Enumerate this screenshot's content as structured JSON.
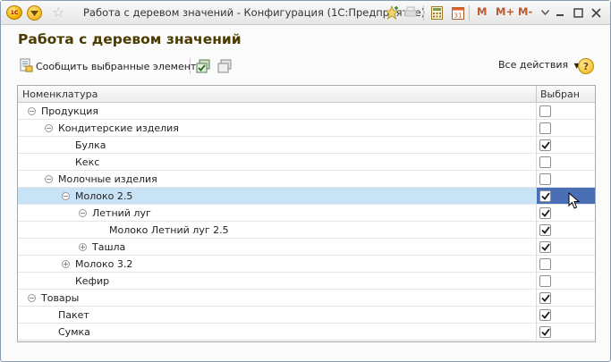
{
  "window": {
    "title": "Работа с деревом значений - Конфигурация  (1С:Предприятие)",
    "logo_text": "1C",
    "toolbar_m": [
      "M",
      "M+",
      "M-"
    ]
  },
  "page": {
    "title": "Работа с деревом значений"
  },
  "toolbar": {
    "report_label": "Сообщить выбранные элементы",
    "all_actions_label": "Все действия",
    "help_label": "?"
  },
  "table": {
    "headers": {
      "name": "Номенклатура",
      "selected": "Выбран"
    },
    "rows": [
      {
        "label": "Продукция",
        "level": 0,
        "toggle": "collapse",
        "checked": false,
        "selected": false
      },
      {
        "label": "Кондитерские изделия",
        "level": 1,
        "toggle": "collapse",
        "checked": false,
        "selected": false
      },
      {
        "label": "Булка",
        "level": 2,
        "toggle": "none",
        "checked": true,
        "selected": false
      },
      {
        "label": "Кекс",
        "level": 2,
        "toggle": "none",
        "checked": false,
        "selected": false
      },
      {
        "label": "Молочные изделия",
        "level": 1,
        "toggle": "collapse",
        "checked": false,
        "selected": false
      },
      {
        "label": "Молоко 2.5",
        "level": 2,
        "toggle": "collapse",
        "checked": true,
        "selected": true
      },
      {
        "label": "Летний луг",
        "level": 3,
        "toggle": "collapse",
        "checked": true,
        "selected": false
      },
      {
        "label": "Молоко Летний луг 2.5",
        "level": 4,
        "toggle": "none",
        "checked": true,
        "selected": false
      },
      {
        "label": "Ташла",
        "level": 3,
        "toggle": "expand",
        "checked": true,
        "selected": false
      },
      {
        "label": "Молоко 3.2",
        "level": 2,
        "toggle": "expand",
        "checked": false,
        "selected": false
      },
      {
        "label": "Кефир",
        "level": 2,
        "toggle": "none",
        "checked": false,
        "selected": false
      },
      {
        "label": "Товары",
        "level": 0,
        "toggle": "collapse",
        "checked": true,
        "selected": false
      },
      {
        "label": "Пакет",
        "level": 1,
        "toggle": "none",
        "checked": true,
        "selected": false
      },
      {
        "label": "Сумка",
        "level": 1,
        "toggle": "none",
        "checked": true,
        "selected": false
      }
    ]
  },
  "colors": {
    "title_text": "#4b3b00",
    "selected_row": "#c9e3f6",
    "selected_cell": "#4a6fb5",
    "m_buttons": "#b85a30"
  }
}
